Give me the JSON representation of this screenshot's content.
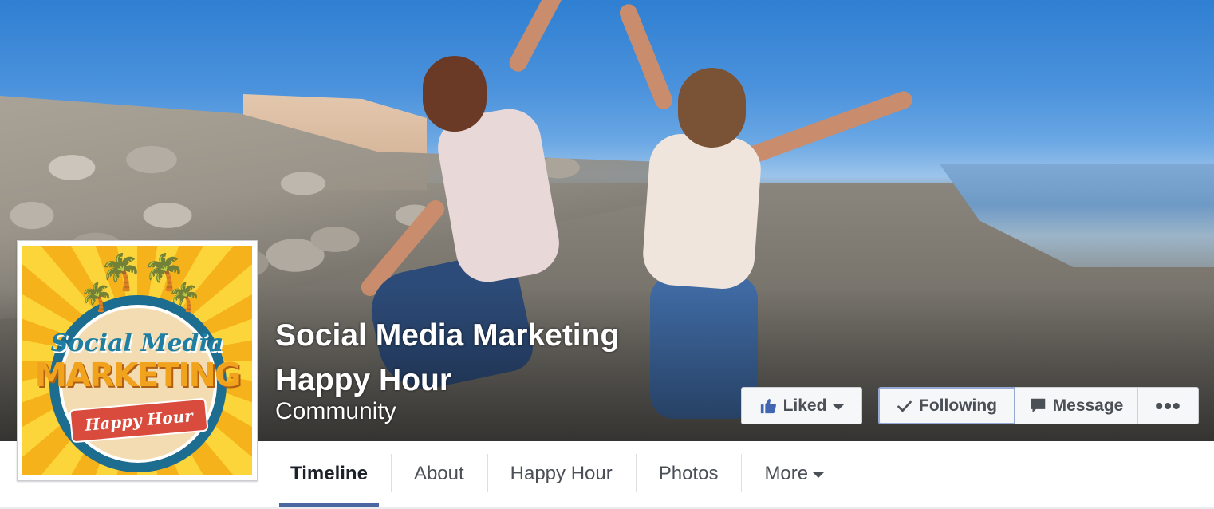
{
  "page": {
    "name": "Social Media Marketing Happy Hour",
    "category": "Community"
  },
  "actions": {
    "liked": "Liked",
    "following": "Following",
    "message": "Message",
    "more": "•••"
  },
  "tabs": [
    "Timeline",
    "About",
    "Happy Hour",
    "Photos",
    "More"
  ],
  "active_tab": "Timeline",
  "logo": {
    "line1": "Social Media",
    "line2": "MARKETING",
    "line3": "Happy Hour"
  },
  "colors": {
    "liked_icon": "#4267b2",
    "tab_underline": "#4b67a1"
  }
}
